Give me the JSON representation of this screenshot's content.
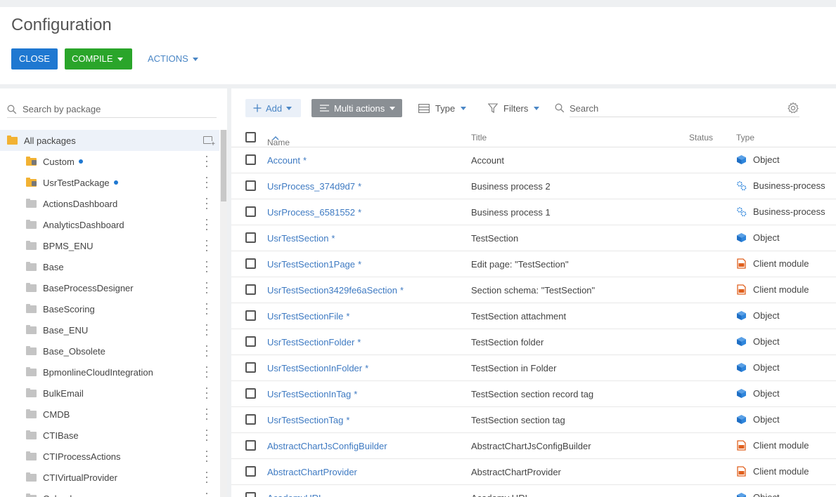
{
  "header": {
    "title": "Configuration",
    "close_label": "CLOSE",
    "compile_label": "COMPILE",
    "actions_label": "ACTIONS"
  },
  "packages": {
    "search_placeholder": "Search by package",
    "all_label": "All packages",
    "items": [
      {
        "name": "Custom",
        "locked": true,
        "dot": true
      },
      {
        "name": "UsrTestPackage",
        "locked": true,
        "dot": true
      },
      {
        "name": "ActionsDashboard",
        "locked": false,
        "dot": false
      },
      {
        "name": "AnalyticsDashboard",
        "locked": false,
        "dot": false
      },
      {
        "name": "BPMS_ENU",
        "locked": false,
        "dot": false
      },
      {
        "name": "Base",
        "locked": false,
        "dot": false
      },
      {
        "name": "BaseProcessDesigner",
        "locked": false,
        "dot": false
      },
      {
        "name": "BaseScoring",
        "locked": false,
        "dot": false
      },
      {
        "name": "Base_ENU",
        "locked": false,
        "dot": false
      },
      {
        "name": "Base_Obsolete",
        "locked": false,
        "dot": false
      },
      {
        "name": "BpmonlineCloudIntegration",
        "locked": false,
        "dot": false
      },
      {
        "name": "BulkEmail",
        "locked": false,
        "dot": false
      },
      {
        "name": "CMDB",
        "locked": false,
        "dot": false
      },
      {
        "name": "CTIBase",
        "locked": false,
        "dot": false
      },
      {
        "name": "CTIProcessActions",
        "locked": false,
        "dot": false
      },
      {
        "name": "CTIVirtualProvider",
        "locked": false,
        "dot": false
      },
      {
        "name": "Calendar",
        "locked": false,
        "dot": false
      }
    ]
  },
  "toolbar": {
    "add_label": "Add",
    "multi_label": "Multi actions",
    "type_label": "Type",
    "filters_label": "Filters",
    "search_placeholder": "Search"
  },
  "grid": {
    "columns": {
      "name": "Name",
      "title": "Title",
      "status": "Status",
      "type": "Type"
    },
    "rows": [
      {
        "name": "Account",
        "modified": true,
        "title": "Account",
        "type": "Object",
        "icon": "object-icon"
      },
      {
        "name": "UsrProcess_374d9d7",
        "modified": true,
        "title": "Business process 2",
        "type": "Business-process",
        "icon": "business-process-icon"
      },
      {
        "name": "UsrProcess_6581552",
        "modified": true,
        "title": "Business process 1",
        "type": "Business-process",
        "icon": "business-process-icon"
      },
      {
        "name": "UsrTestSection",
        "modified": true,
        "title": "TestSection",
        "type": "Object",
        "icon": "object-icon"
      },
      {
        "name": "UsrTestSection1Page",
        "modified": true,
        "title": "Edit page: \"TestSection\"",
        "type": "Client module",
        "icon": "client-module-icon"
      },
      {
        "name": "UsrTestSection3429fe6aSection",
        "modified": true,
        "title": "Section schema: \"TestSection\"",
        "type": "Client module",
        "icon": "client-module-icon"
      },
      {
        "name": "UsrTestSectionFile",
        "modified": true,
        "title": "TestSection attachment",
        "type": "Object",
        "icon": "object-icon"
      },
      {
        "name": "UsrTestSectionFolder",
        "modified": true,
        "title": "TestSection folder",
        "type": "Object",
        "icon": "object-icon"
      },
      {
        "name": "UsrTestSectionInFolder",
        "modified": true,
        "title": "TestSection in Folder",
        "type": "Object",
        "icon": "object-icon"
      },
      {
        "name": "UsrTestSectionInTag",
        "modified": true,
        "title": "TestSection section record tag",
        "type": "Object",
        "icon": "object-icon"
      },
      {
        "name": "UsrTestSectionTag",
        "modified": true,
        "title": "TestSection section tag",
        "type": "Object",
        "icon": "object-icon"
      },
      {
        "name": "AbstractChartJsConfigBuilder",
        "modified": false,
        "title": "AbstractChartJsConfigBuilder",
        "type": "Client module",
        "icon": "client-module-icon"
      },
      {
        "name": "AbstractChartProvider",
        "modified": false,
        "title": "AbstractChartProvider",
        "type": "Client module",
        "icon": "client-module-icon"
      },
      {
        "name": "AcademyURL",
        "modified": false,
        "title": "Academy URL",
        "type": "Object",
        "icon": "object-icon"
      }
    ]
  },
  "colors": {
    "close": "#1f78d1",
    "compile": "#2aa52a",
    "link": "#3e7ac2",
    "multi": "#8a8f94",
    "folder_gold": "#f2b233",
    "folder_gray": "#c4c4c4"
  }
}
